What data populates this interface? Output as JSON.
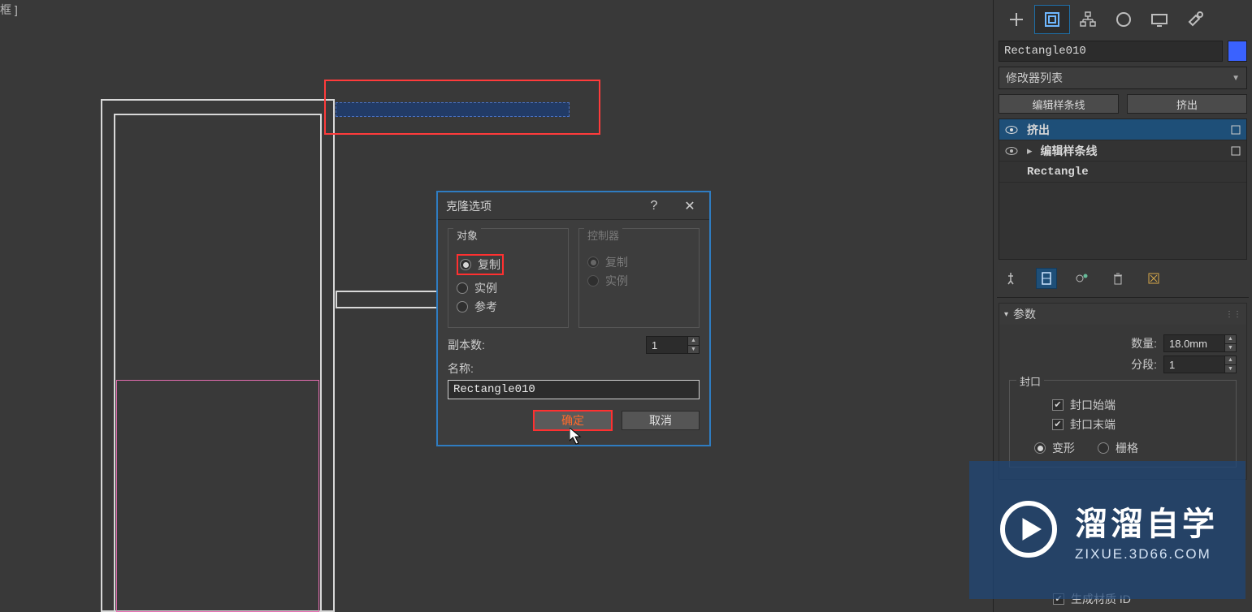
{
  "viewport": {
    "label": "框 ]"
  },
  "dialog": {
    "title": "克隆选项",
    "object_legend": "对象",
    "controller_legend": "控制器",
    "obj_copy": "复制",
    "obj_instance": "实例",
    "obj_reference": "参考",
    "ctl_copy": "复制",
    "ctl_instance": "实例",
    "copies_label": "副本数:",
    "copies_value": "1",
    "name_label": "名称:",
    "name_value": "Rectangle010",
    "ok": "确定",
    "cancel": "取消"
  },
  "panel": {
    "object_name": "Rectangle010",
    "modifier_dropdown": "修改器列表",
    "btn_editspline": "编辑样条线",
    "btn_extrude": "挤出",
    "stack": {
      "extrude": "挤出",
      "editspline": "编辑样条线",
      "rectangle": "Rectangle"
    },
    "params_title": "参数",
    "amount_label": "数量:",
    "amount_value": "18.0mm",
    "segments_label": "分段:",
    "segments_value": "1",
    "cap_legend": "封口",
    "cap_start": "封口始端",
    "cap_end": "封口末端",
    "cap_morph": "变形",
    "cap_grid": "栅格",
    "gen_mat_id": "生成材质 ID"
  },
  "watermark": {
    "brand": "溜溜自学",
    "url": "ZIXUE.3D66.COM"
  }
}
